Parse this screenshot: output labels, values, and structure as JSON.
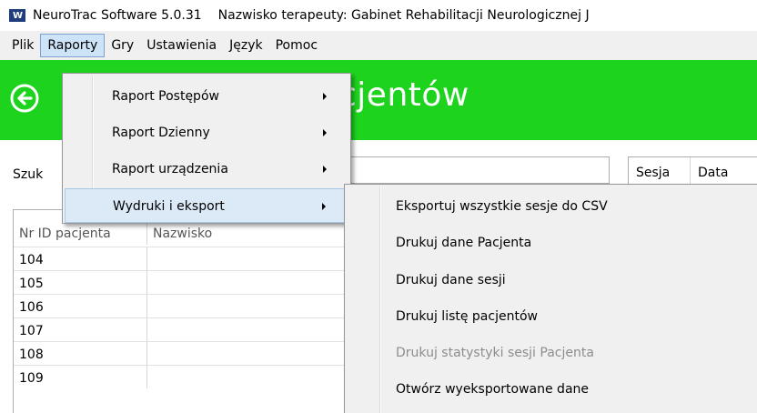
{
  "window": {
    "app_name": "NeuroTrac Software 5.0.31",
    "therapist_info": "Nazwisko terapeuty: Gabinet Rehabilitacji Neurologicznej J"
  },
  "menubar": {
    "items": [
      {
        "label": "Plik"
      },
      {
        "label": "Raporty",
        "open": true
      },
      {
        "label": "Gry"
      },
      {
        "label": "Ustawienia"
      },
      {
        "label": "Język"
      },
      {
        "label": "Pomoc"
      }
    ]
  },
  "header": {
    "title_partial": "cjentów",
    "color": "#1ed31e",
    "back_icon": "back-arrow-circle-icon"
  },
  "search": {
    "label_partial": "Szuk"
  },
  "sessions_table": {
    "columns": [
      "Sesja",
      "Data"
    ]
  },
  "patients_table": {
    "columns": [
      "Nr ID pacjenta",
      "Nazwisko"
    ],
    "rows": [
      {
        "id": "104",
        "name": ""
      },
      {
        "id": "105",
        "name": ""
      },
      {
        "id": "106",
        "name": ""
      },
      {
        "id": "107",
        "name": ""
      },
      {
        "id": "108",
        "name": ""
      },
      {
        "id": "109",
        "name": ""
      }
    ]
  },
  "raporty_menu": {
    "items": [
      {
        "label": "Raport Postępów",
        "has_submenu": true
      },
      {
        "label": "Raport Dzienny",
        "has_submenu": true
      },
      {
        "label": "Raport urządzenia",
        "has_submenu": true
      },
      {
        "label": "Wydruki i eksport",
        "has_submenu": true,
        "highlighted": true
      }
    ]
  },
  "wydruki_submenu": {
    "items": [
      {
        "label": "Eksportuj wszystkie sesje do CSV",
        "enabled": true
      },
      {
        "label": "Drukuj dane Pacjenta",
        "enabled": true
      },
      {
        "label": "Drukuj dane sesji",
        "enabled": true
      },
      {
        "label": "Drukuj listę pacjentów",
        "enabled": true
      },
      {
        "label": "Drukuj statystyki sesji Pacjenta",
        "enabled": false
      },
      {
        "label": "Otwórz wyeksportowane dane",
        "enabled": true
      }
    ]
  }
}
